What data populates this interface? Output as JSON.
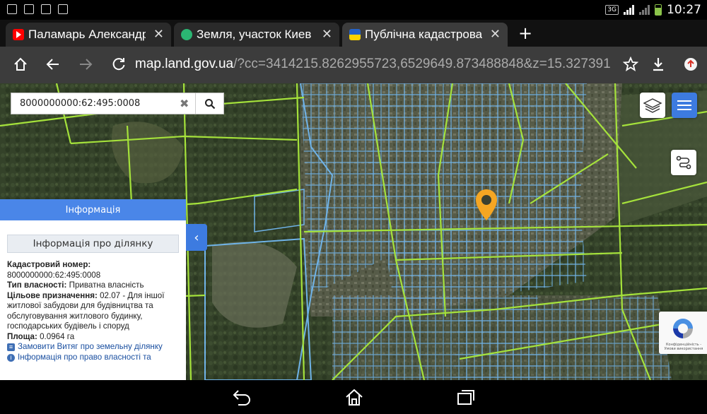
{
  "status_bar": {
    "network": "3G",
    "time": "10:27"
  },
  "tabs": [
    {
      "title": "Паламарь Александр",
      "favicon": "youtube-icon",
      "favicon_color": "#ff0000"
    },
    {
      "title": "Земля, участок Киев -",
      "favicon": "site-icon",
      "favicon_color": "#2bb673"
    },
    {
      "title": "Публічна кадастрова к",
      "favicon": "ukraine-flag-icon",
      "favicon_color": "#ffd500"
    }
  ],
  "toolbar": {
    "url_domain": "map.land.gov.ua",
    "url_rest": "/?cc=3414215.8262955723,6529649.873488848&z=15.327391"
  },
  "search": {
    "value": "8000000000:62:495:0008"
  },
  "panel": {
    "header": "Інформація",
    "subheader": "Інформація про ділянку",
    "cadastral_label": "Кадастровий номер:",
    "cadastral_value": "8000000000:62:495:0008",
    "ownership_label": "Тип власності:",
    "ownership_value": "Приватна власність",
    "purpose_label": "Цільове призначення:",
    "purpose_value": "02.07 - Для іншої житлової забудови для будівництва та обслуговування житлового будинку, господарських будівель і споруд",
    "area_label": "Площа:",
    "area_value": "0.0964 га",
    "link_extract": "Замовити Витяг про земельну ділянку",
    "link_rights": "Інформація про право власності та"
  },
  "recaptcha": {
    "text": "Конфіденційність - Умови використання"
  },
  "colors": {
    "accent": "#4a86e8",
    "parcel_line": "#6fb3e8",
    "boundary_line": "#a5e23b",
    "marker": "#f5a623"
  }
}
